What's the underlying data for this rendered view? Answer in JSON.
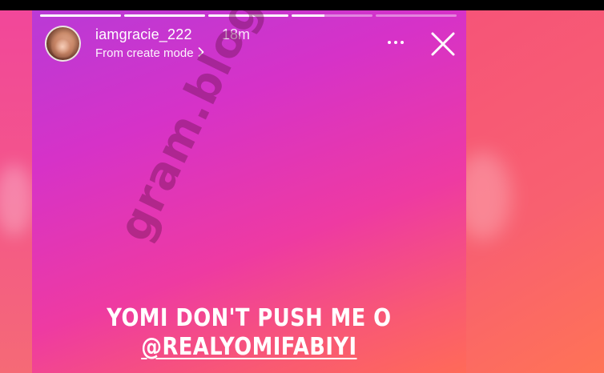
{
  "story": {
    "username": "iamgracie_222",
    "time": "18m",
    "subtitle": "From create mode",
    "progress": [
      1,
      1,
      1,
      0.4,
      0
    ],
    "caption_line1": "YOMI DON'T PUSH ME O",
    "caption_line2": "@REALYOMIFABIYI",
    "watermark": "gram.blog"
  },
  "icons": {
    "avatar": "profile-photo",
    "chevron": "chevron-right-icon",
    "more": "more-horizontal-icon",
    "close": "close-icon"
  },
  "colors": {
    "text": "#ffffff",
    "gradient_start": "#b93ad6",
    "gradient_end": "#ff6a58"
  }
}
